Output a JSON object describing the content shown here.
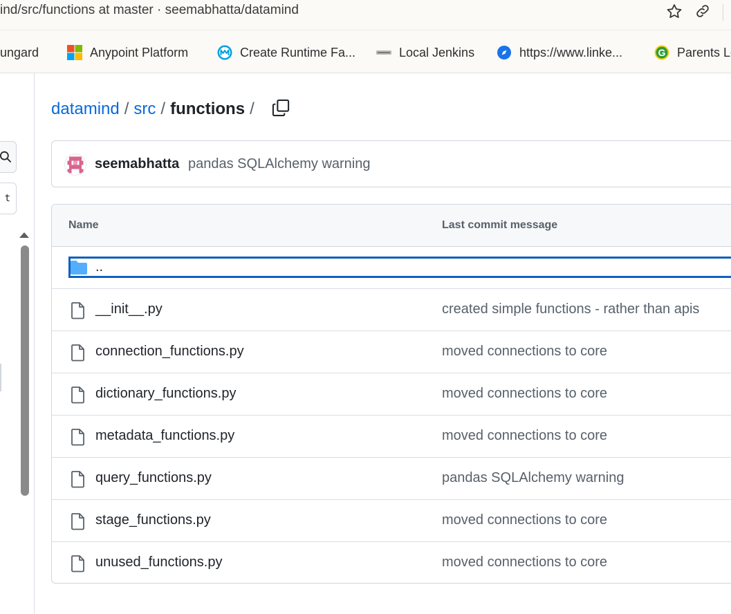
{
  "browser": {
    "url_text": "ind/src/functions at master · seemabhatta/datamind"
  },
  "bookmarks": [
    {
      "label": "ungard",
      "icon": "none"
    },
    {
      "label": "Anypoint Platform",
      "icon": "microsoft-logo-icon"
    },
    {
      "label": "Create Runtime Fa...",
      "icon": "mulesoft-logo-icon"
    },
    {
      "label": "Local Jenkins",
      "icon": "jenkins-icon"
    },
    {
      "label": "https://www.linke...",
      "icon": "compass-icon"
    },
    {
      "label": "Parents Lo",
      "icon": "g-logo-icon"
    }
  ],
  "sidebar": {
    "t_button": "t"
  },
  "breadcrumb": {
    "repo": "datamind",
    "sep1": "/",
    "folder": "src",
    "sep2": "/",
    "current": "functions",
    "sep3": "/"
  },
  "commit": {
    "author": "seemabhatta",
    "message": "pandas SQLAlchemy warning"
  },
  "table": {
    "col_name": "Name",
    "col_message": "Last commit message",
    "parent_dir": "..",
    "rows": [
      {
        "name": "__init__.py",
        "message": "created simple functions - rather than apis"
      },
      {
        "name": "connection_functions.py",
        "message": "moved connections to core"
      },
      {
        "name": "dictionary_functions.py",
        "message": "moved connections to core"
      },
      {
        "name": "metadata_functions.py",
        "message": "moved connections to core"
      },
      {
        "name": "query_functions.py",
        "message": "pandas SQLAlchemy warning"
      },
      {
        "name": "stage_functions.py",
        "message": "moved connections to core"
      },
      {
        "name": "unused_functions.py",
        "message": "moved connections to core"
      }
    ]
  },
  "colors": {
    "link": "#0969da",
    "border": "#d0d7de",
    "focus": "#0f5fbf",
    "folder": "#54aeff"
  }
}
